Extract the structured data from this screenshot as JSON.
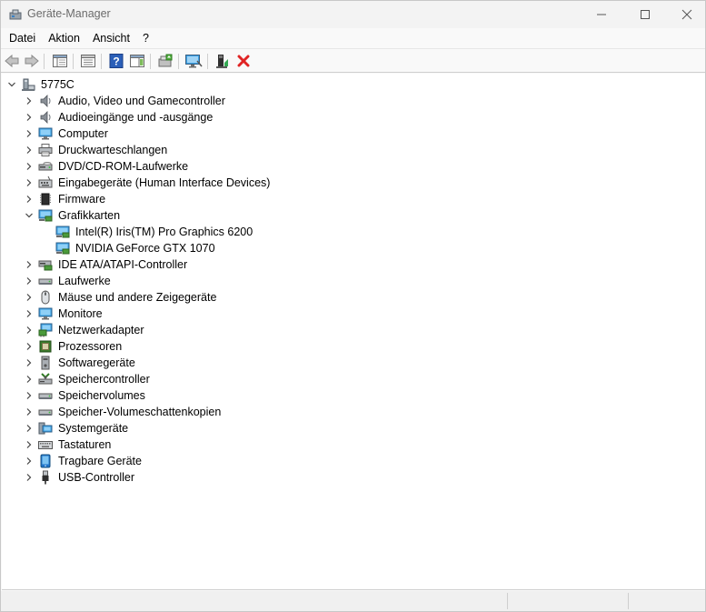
{
  "window": {
    "title": "Geräte-Manager"
  },
  "menu": [
    "Datei",
    "Aktion",
    "Ansicht",
    "?"
  ],
  "tree": {
    "root": "5775C",
    "categories": [
      {
        "label": "Audio, Video und Gamecontroller",
        "icon": "speaker-icon",
        "expanded": false
      },
      {
        "label": "Audioeingänge und -ausgänge",
        "icon": "speaker-icon",
        "expanded": false
      },
      {
        "label": "Computer",
        "icon": "monitor-icon",
        "expanded": false
      },
      {
        "label": "Druckwarteschlangen",
        "icon": "printer-icon",
        "expanded": false
      },
      {
        "label": "DVD/CD-ROM-Laufwerke",
        "icon": "disc-drive-icon",
        "expanded": false
      },
      {
        "label": "Eingabegeräte (Human Interface Devices)",
        "icon": "keyboard-hid-icon",
        "expanded": false
      },
      {
        "label": "Firmware",
        "icon": "chip-icon",
        "expanded": false
      },
      {
        "label": "Grafikkarten",
        "icon": "display-adapter-icon",
        "expanded": true,
        "children": [
          "Intel(R) Iris(TM) Pro Graphics 6200",
          "NVIDIA GeForce GTX 1070"
        ]
      },
      {
        "label": "IDE ATA/ATAPI-Controller",
        "icon": "ide-controller-icon",
        "expanded": false
      },
      {
        "label": "Laufwerke",
        "icon": "hard-drive-icon",
        "expanded": false
      },
      {
        "label": "Mäuse und andere Zeigegeräte",
        "icon": "mouse-icon",
        "expanded": false
      },
      {
        "label": "Monitore",
        "icon": "monitor-icon",
        "expanded": false
      },
      {
        "label": "Netzwerkadapter",
        "icon": "network-adapter-icon",
        "expanded": false
      },
      {
        "label": "Prozessoren",
        "icon": "processor-icon",
        "expanded": false
      },
      {
        "label": "Softwaregeräte",
        "icon": "software-device-icon",
        "expanded": false
      },
      {
        "label": "Speichercontroller",
        "icon": "storage-controller-icon",
        "expanded": false
      },
      {
        "label": "Speichervolumes",
        "icon": "hard-drive-icon",
        "expanded": false
      },
      {
        "label": "Speicher-Volumeschattenkopien",
        "icon": "hard-drive-icon",
        "expanded": false
      },
      {
        "label": "Systemgeräte",
        "icon": "system-device-icon",
        "expanded": false
      },
      {
        "label": "Tastaturen",
        "icon": "keyboard-icon",
        "expanded": false
      },
      {
        "label": "Tragbare Geräte",
        "icon": "portable-device-icon",
        "expanded": false
      },
      {
        "label": "USB-Controller",
        "icon": "usb-icon",
        "expanded": false
      }
    ]
  },
  "colors": {
    "uninstall_red": "#e02424",
    "help_blue": "#2b5fb8",
    "monitor_blue": "#3aa0e6"
  }
}
